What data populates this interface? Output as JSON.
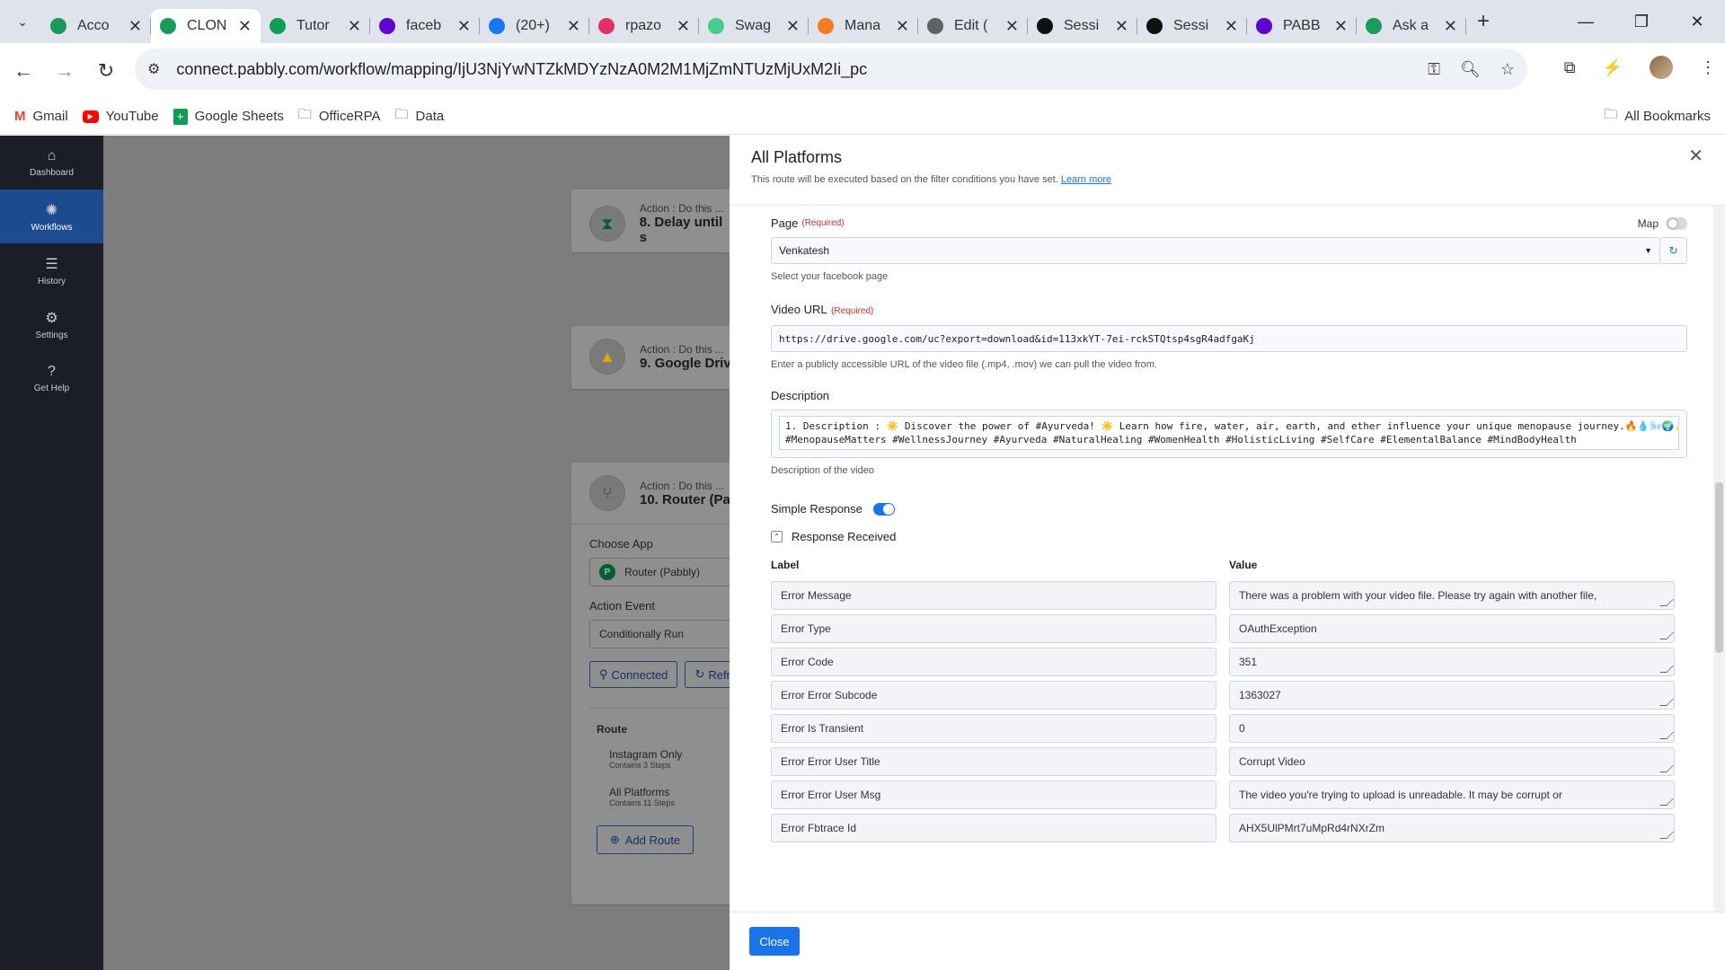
{
  "browser": {
    "tabs": [
      {
        "title": "Acco",
        "icon": "pabbly-icon",
        "color": "#1a9b5c"
      },
      {
        "title": "CLON",
        "icon": "pabbly-icon",
        "color": "#1a9b5c",
        "active": true
      },
      {
        "title": "Tutor",
        "icon": "sheets-icon",
        "color": "#0f9d58"
      },
      {
        "title": "faceb",
        "icon": "yahoo-icon",
        "color": "#5f01d1"
      },
      {
        "title": "(20+)",
        "icon": "facebook-icon",
        "color": "#1877f2"
      },
      {
        "title": "rpazo",
        "icon": "instagram-icon",
        "color": "#e1306c"
      },
      {
        "title": "Swag",
        "icon": "swagger-icon",
        "color": "#49cc90"
      },
      {
        "title": "Mana",
        "icon": "make-icon",
        "color": "#f47c20"
      },
      {
        "title": "Edit (",
        "icon": "globe-icon",
        "color": "#5f6368"
      },
      {
        "title": "Sessi",
        "icon": "session-icon",
        "color": "#111111"
      },
      {
        "title": "Sessi",
        "icon": "session-icon",
        "color": "#111111"
      },
      {
        "title": "PABB",
        "icon": "yahoo-icon",
        "color": "#5f01d1"
      },
      {
        "title": "Ask a",
        "icon": "pabbly-icon",
        "color": "#1a9b5c"
      }
    ],
    "url": "connect.pabbly.com/workflow/mapping/IjU3NjYwNTZkMDYzNzA0M2M1MjZmNTUzMjUxM2Ii_pc",
    "bookmarks": [
      "Gmail",
      "YouTube",
      "Google Sheets",
      "OfficeRPA",
      "Data"
    ],
    "all_bookmarks": "All Bookmarks"
  },
  "sidebar": {
    "items": [
      {
        "label": "Dashboard",
        "icon": "home-icon"
      },
      {
        "label": "Workflows",
        "icon": "workflows-icon",
        "active": true
      },
      {
        "label": "History",
        "icon": "list-icon"
      },
      {
        "label": "Settings",
        "icon": "gear-icon"
      },
      {
        "label": "Get Help",
        "icon": "help-icon"
      }
    ]
  },
  "canvas": {
    "step8": {
      "sub": "Action : Do this ...",
      "title": "8. Delay until s"
    },
    "step9": {
      "sub": "Action : Do this ...",
      "title": "9. Google Driv"
    },
    "step10": {
      "sub": "Action : Do this ...",
      "title": "10. Router (Pa"
    },
    "choose_app_label": "Choose App",
    "choose_app_value": "Router (Pabbly)",
    "action_event_label": "Action Event",
    "action_event_value": "Conditionally Run",
    "connected_btn": "Connected",
    "refresh_btn": "Refr",
    "route_label": "Route",
    "routes": [
      {
        "name": "Instagram Only",
        "steps": "Contains 3 Steps"
      },
      {
        "name": "All Platforms",
        "steps": "Contains 11 Steps"
      }
    ],
    "add_route_btn": "Add Route"
  },
  "modal": {
    "title": "All Platforms",
    "subtitle": "This route will be executed based on the filter conditions you have set.",
    "learn_more": "Learn more",
    "page": {
      "label": "Page",
      "required": "(Required)",
      "map_label": "Map",
      "value": "Venkatesh",
      "help": "Select your facebook page"
    },
    "video_url": {
      "label": "Video URL",
      "required": "(Required)",
      "value": "https://drive.google.com/uc?export=download&id=113xkYT-7ei-rckSTQtsp4sgR4adfgaKj",
      "help": "Enter a publicly accessible URL of the video file (.mp4, .mov) we can pull the video from."
    },
    "description": {
      "label": "Description",
      "line1": "1. Description : ☀️ Discover the power of #Ayurveda! ☀️ Learn how fire, water, air, earth, and ether influence your unique menopause journey.🔥💧🌬️🌍✨",
      "line2": "#MenopauseMatters #WellnessJourney #Ayurveda #NaturalHealing #WomenHealth #HolisticLiving #SelfCare #ElementalBalance #MindBodyHealth",
      "help": "Description of the video"
    },
    "simple_response_label": "Simple Response",
    "response_received_label": "Response Received",
    "col_label": "Label",
    "col_value": "Value",
    "rows": [
      {
        "label": "Error Message",
        "value": "There was a problem with your video file. Please try again with another file,"
      },
      {
        "label": "Error Type",
        "value": "OAuthException"
      },
      {
        "label": "Error Code",
        "value": "351"
      },
      {
        "label": "Error Error Subcode",
        "value": "1363027"
      },
      {
        "label": "Error Is Transient",
        "value": "0"
      },
      {
        "label": "Error Error User Title",
        "value": "Corrupt Video"
      },
      {
        "label": "Error Error User Msg",
        "value": "The video you're trying to upload is unreadable. It may be corrupt or"
      },
      {
        "label": "Error Fbtrace Id",
        "value": "AHX5UlPMrt7uMpRd4rNXrZm"
      }
    ],
    "close_btn": "Close"
  },
  "colors": {
    "accent": "#1a73e8",
    "sidebar_bg": "#1b1e27",
    "sidebar_active": "#1d4b8f",
    "toggle_on": "#1a73e8",
    "required": "#d32f2f"
  }
}
